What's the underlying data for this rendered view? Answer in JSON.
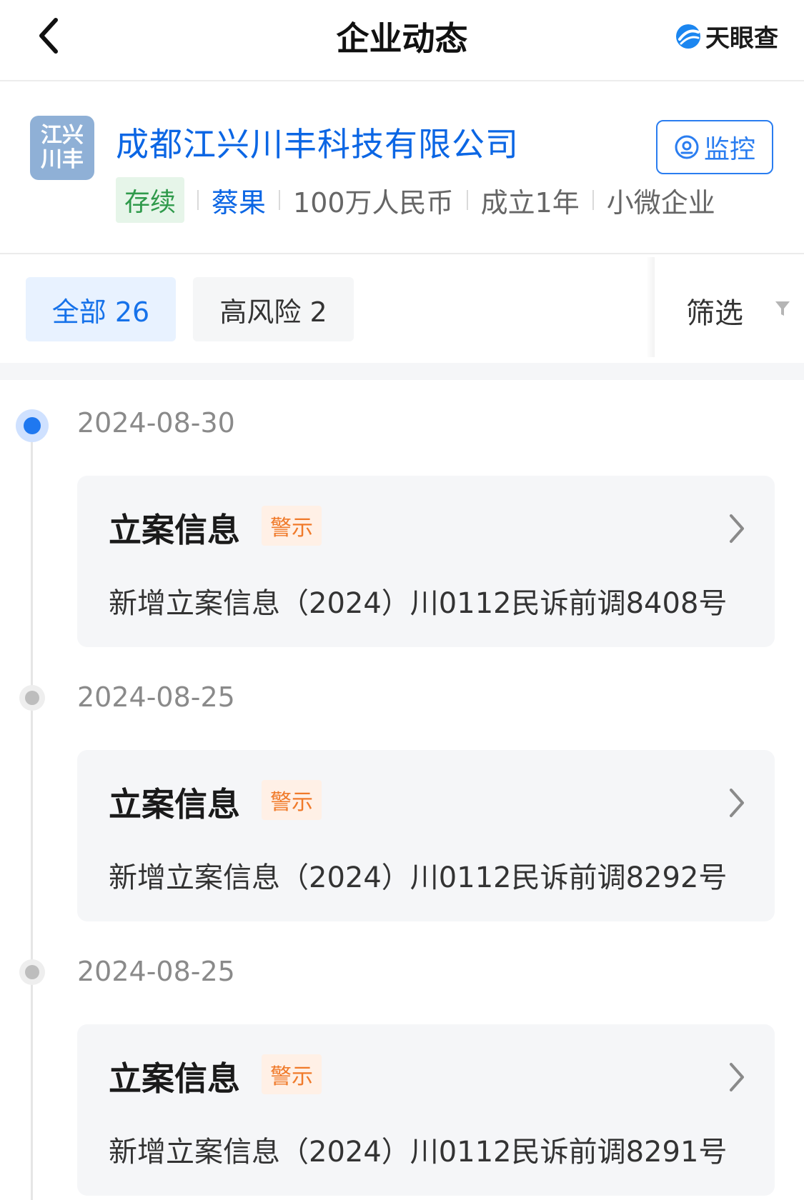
{
  "header": {
    "title": "企业动态",
    "brand": "天眼查"
  },
  "company": {
    "logo_line1": "江兴",
    "logo_line2": "川丰",
    "name": "成都江兴川丰科技有限公司",
    "monitor_label": "监控",
    "status": "存续",
    "legal_rep": "蔡果",
    "capital": "100万人民币",
    "founded": "成立1年",
    "scale": "小微企业"
  },
  "tabs": [
    {
      "label": "全部 26"
    },
    {
      "label": "高风险 2"
    }
  ],
  "filter_label": "筛选",
  "timeline": [
    {
      "date": "2024-08-30",
      "title": "立案信息",
      "tag": "警示",
      "desc": "新增立案信息（2024）川0112民诉前调8408号"
    },
    {
      "date": "2024-08-25",
      "title": "立案信息",
      "tag": "警示",
      "desc": "新增立案信息（2024）川0112民诉前调8292号"
    },
    {
      "date": "2024-08-25",
      "title": "立案信息",
      "tag": "警示",
      "desc": "新增立案信息（2024）川0112民诉前调8291号"
    }
  ],
  "colors": {
    "accent": "#1672ea",
    "warning": "#f07a2a",
    "active": "#2f9a4b"
  }
}
